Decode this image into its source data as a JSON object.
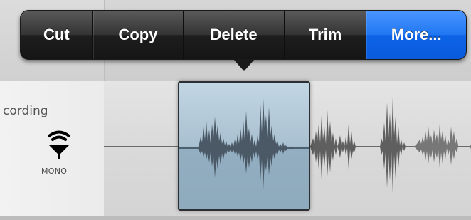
{
  "edit_menu": {
    "items": [
      {
        "label": "Cut"
      },
      {
        "label": "Copy"
      },
      {
        "label": "Delete"
      },
      {
        "label": "Trim"
      },
      {
        "label": "More..."
      }
    ],
    "highlighted_index": 4,
    "highlight_color": "#1a6ff0"
  },
  "track": {
    "name": "cording",
    "channel_label": "MONO",
    "icon": "mono-input-icon"
  },
  "colors": {
    "selection_fill": "#a9c0d0",
    "waveform": "#555555",
    "menu_background": "#2a2a2a"
  }
}
